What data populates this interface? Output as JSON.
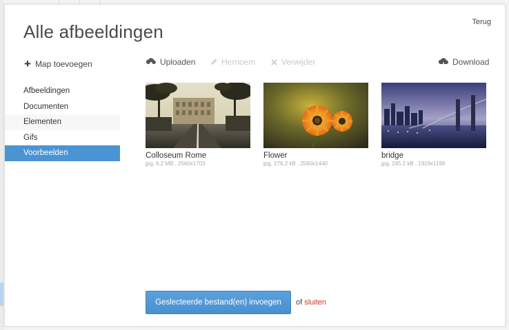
{
  "modal": {
    "title": "Alle afbeeldingen",
    "back_label": "Terug",
    "add_folder_label": "Map toevoegen"
  },
  "sidebar": {
    "items": [
      {
        "label": "Afbeeldingen"
      },
      {
        "label": "Documenten"
      },
      {
        "label": "Elementen"
      },
      {
        "label": "Gifs"
      },
      {
        "label": "Voorbeelden"
      }
    ],
    "active_index": 4
  },
  "toolbar": {
    "upload_label": "Uploaden",
    "rename_label": "Hernoem",
    "delete_label": "Verwijder",
    "download_label": "Download"
  },
  "files": [
    {
      "name": "Colloseum Rome",
      "meta": "jpg, 6.2 MB , 2560x1703"
    },
    {
      "name": "Flower",
      "meta": "jpg, 276.2 kB , 2560x1440"
    },
    {
      "name": "bridge",
      "meta": "jpg, 245.2 kB , 1919x1199"
    }
  ],
  "footer": {
    "insert_label": "Geslecteerde bestand(en) invoegen",
    "or_text": "of",
    "close_label": "sluiten"
  },
  "colors": {
    "accent": "#4a94d3",
    "close_link": "#c0392b",
    "disabled_text": "#c9c9c9"
  },
  "icons": {
    "add_folder": "plus-icon",
    "upload": "cloud-upload-icon",
    "rename": "pencil-icon",
    "delete": "x-icon",
    "download": "cloud-download-icon"
  }
}
